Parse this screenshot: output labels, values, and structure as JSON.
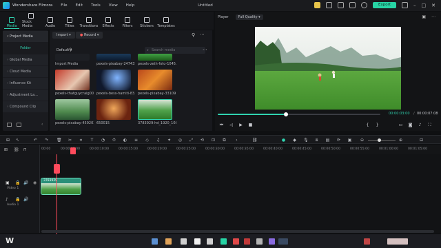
{
  "app": {
    "name": "Wondershare Filmora",
    "doc_title": "Untitled",
    "export_label": "Export"
  },
  "menu": [
    "File",
    "Edit",
    "Tools",
    "View",
    "Help"
  ],
  "tabs": [
    {
      "label": "Media",
      "active": true
    },
    {
      "label": "Stock Media"
    },
    {
      "label": "Audio"
    },
    {
      "label": "Titles"
    },
    {
      "label": "Transitions"
    },
    {
      "label": "Effects"
    },
    {
      "label": "Filters"
    },
    {
      "label": "Stickers"
    },
    {
      "label": "Templates"
    }
  ],
  "sidebar": {
    "items": [
      {
        "label": "Project Media",
        "head": true
      },
      {
        "label": "Folder",
        "folder": true
      },
      {
        "label": "Global Media"
      },
      {
        "label": "Cloud Media"
      },
      {
        "label": "Influence Kit"
      },
      {
        "label": "Adjustment La..."
      },
      {
        "label": "Compound Clip"
      }
    ]
  },
  "media": {
    "import_label": "Import",
    "record_label": "Record",
    "sort_label": "Default",
    "search_placeholder": "Search media",
    "items": [
      {
        "label": "Import Media"
      },
      {
        "label": "pexels-pixabay-247431"
      },
      {
        "label": "pexels-zeth-foto-1045..."
      },
      {
        "label": "pexels-thatguycraig00..."
      },
      {
        "label": "pexels-bess-hamiti-83..."
      },
      {
        "label": "pexels-pixabay-33109"
      },
      {
        "label": "pexels-pixabay-459203"
      },
      {
        "label": "650015"
      },
      {
        "label": "3783929-hd_1920_108..."
      }
    ]
  },
  "player": {
    "label": "Player",
    "quality": "Full Quality",
    "current_time": "00:00:03:00",
    "total_time": "00:00:07:08",
    "progress": 0.42
  },
  "timeline": {
    "ruler": [
      "00:00",
      "00:00:05:00",
      "00:00:10:00",
      "00:00:15:00",
      "00:00:20:00",
      "00:00:25:00",
      "00:00:30:00",
      "00:00:35:00",
      "00:00:40:00",
      "00:00:45:00",
      "00:00:50:00",
      "00:00:55:00",
      "00:01:00:00",
      "00:01:05:00"
    ],
    "video_track": "Video 1",
    "audio_track": "Audio 1",
    "clip_label": "3783929"
  },
  "colors": {
    "accent": "#30d3b0",
    "playhead": "#ff4b5c"
  }
}
